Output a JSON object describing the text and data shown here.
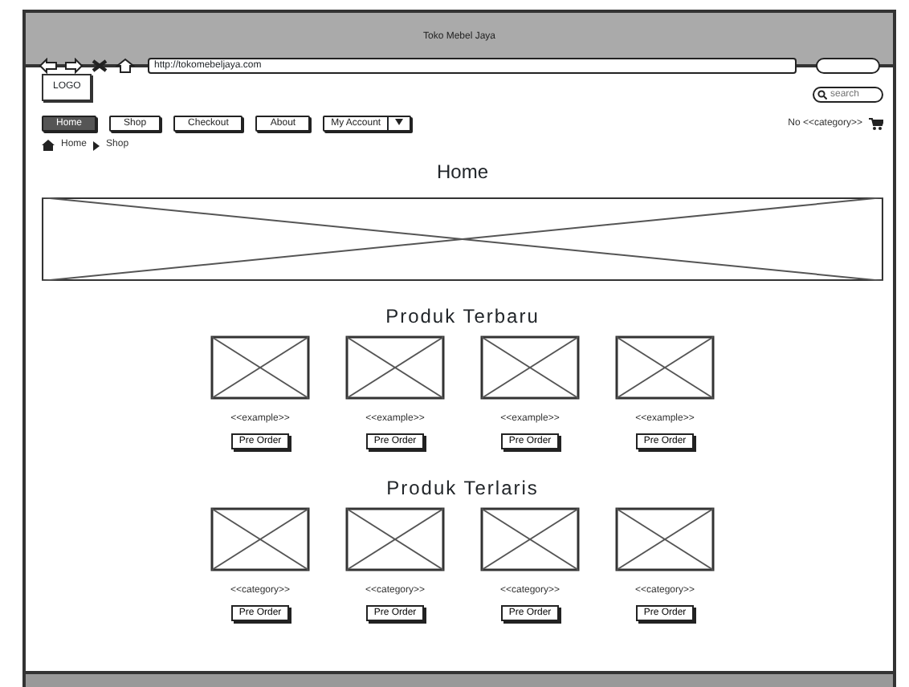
{
  "window": {
    "title": "Toko Mebel Jaya",
    "url": "http://tokomebeljaya.com"
  },
  "toolbar": {
    "buttons": [
      {
        "kind": "back"
      },
      {
        "kind": "forward"
      },
      {
        "kind": "stop"
      },
      {
        "kind": "home"
      }
    ]
  },
  "logo": "LOGO",
  "search": {
    "placeholder": "search"
  },
  "nav": [
    {
      "label": "Home",
      "selected": true,
      "kind": "button"
    },
    {
      "label": "Shop",
      "selected": false,
      "kind": "button"
    },
    {
      "label": "Checkout",
      "selected": false,
      "kind": "button"
    },
    {
      "label": "About",
      "selected": false,
      "kind": "button"
    },
    {
      "label": "My Account",
      "selected": false,
      "kind": "dropdown"
    }
  ],
  "cart": "No <<category>>",
  "breadcrumb": [
    "Home",
    "Shop"
  ],
  "page_title": "Home",
  "sections": [
    {
      "title": "Produk Terbaru",
      "products": [
        {
          "label": "<<example>>",
          "button": "Pre Order"
        },
        {
          "label": "<<example>>",
          "button": "Pre Order"
        },
        {
          "label": "<<example>>",
          "button": "Pre Order"
        },
        {
          "label": "<<example>>",
          "button": "Pre Order"
        }
      ]
    },
    {
      "title": "Produk Terlaris",
      "products": [
        {
          "label": "<<category>>",
          "button": "Pre Order"
        },
        {
          "label": "<<category>>",
          "button": "Pre Order"
        },
        {
          "label": "<<category>>",
          "button": "Pre Order"
        },
        {
          "label": "<<category>>",
          "button": "Pre Order"
        }
      ]
    }
  ]
}
